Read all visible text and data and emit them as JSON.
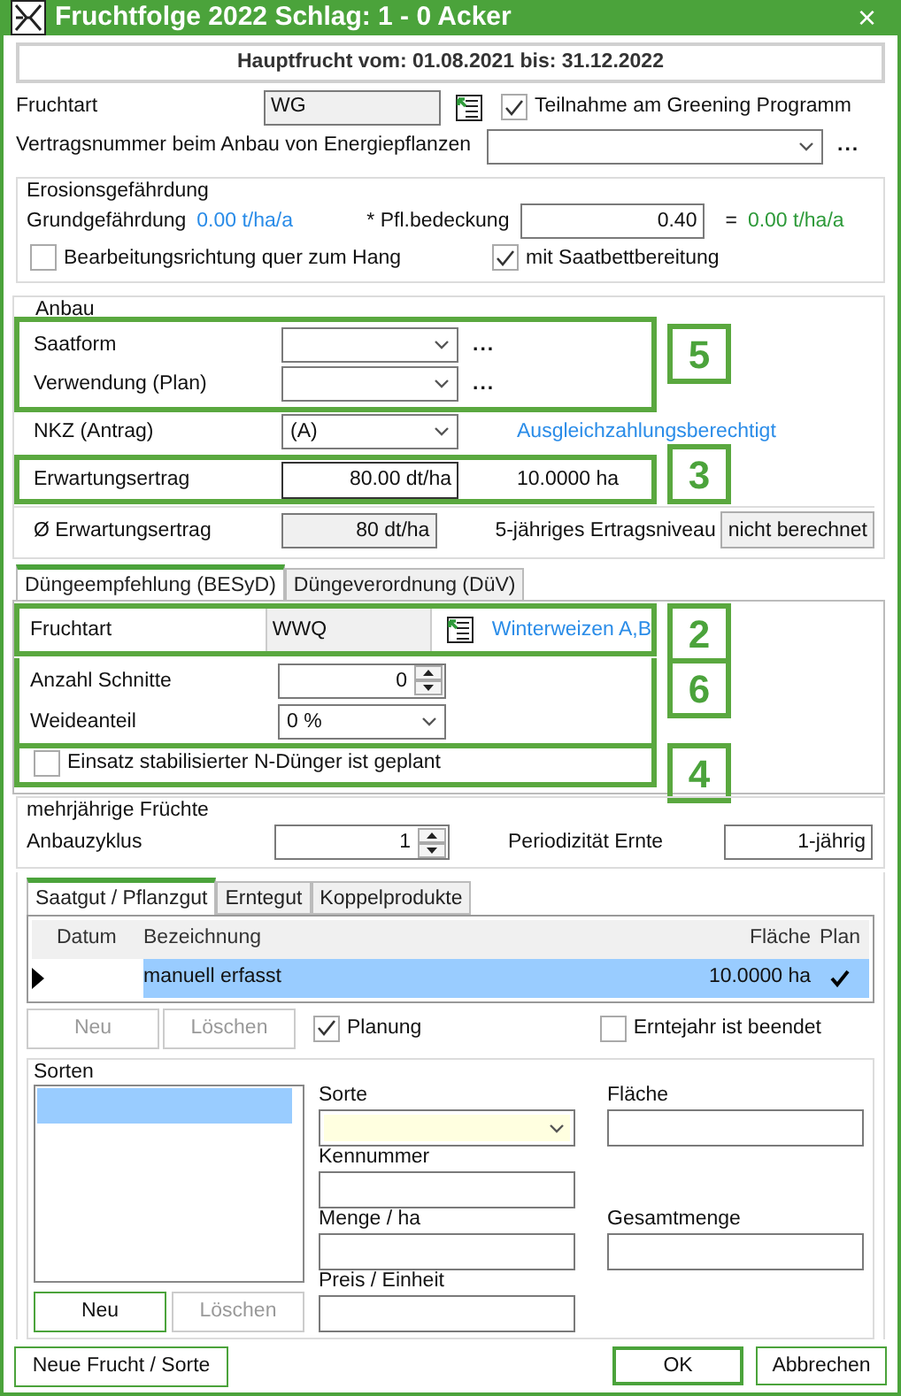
{
  "window": {
    "title": "Fruchtfolge 2022 Schlag: 1 - 0 Acker",
    "close": "×"
  },
  "header": "Hauptfrucht vom: 01.08.2021 bis: 31.12.2022",
  "fruchtart": {
    "label": "Fruchtart",
    "value": "WG",
    "greening": {
      "label": "Teilnahme am Greening Programm",
      "checked": true
    }
  },
  "vertrag": {
    "label": "Vertragsnummer beim Anbau von Energiepflanzen",
    "more": "..."
  },
  "erosion": {
    "title": "Erosionsgefährdung",
    "grund_label": "Grundgefährdung",
    "grund_value": "0.00 t/ha/a",
    "factor_label": "* Pfl.bedeckung",
    "factor_value": "0.40",
    "equals": "=",
    "result": "0.00 t/ha/a",
    "checks": [
      {
        "label": "Bearbeitungsrichtung quer zum Hang",
        "checked": false
      },
      {
        "label": "mit Saatbettbereitung",
        "checked": true
      }
    ]
  },
  "anbau": {
    "title": "Anbau",
    "callout": "5",
    "rows": [
      {
        "label": "Saatform",
        "more": "..."
      },
      {
        "label": "Verwendung (Plan)",
        "more": "..."
      }
    ]
  },
  "nkz": {
    "label": "NKZ  (Antrag)",
    "value": "(A)",
    "link": "Ausgleichzahlungsberechtigt"
  },
  "ertrag": {
    "callout": "3",
    "label": "Erwartungsertrag",
    "value": "80.00 dt/ha",
    "area": "10.0000 ha"
  },
  "durchschnitt": {
    "label": "Ø Erwartungsertrag",
    "value": "80 dt/ha",
    "niveau_label": "5-jähriges Ertragsniveau",
    "niveau_button": "nicht berechnet"
  },
  "duenge_tabs": [
    {
      "label": "Düngeempfehlung (BESyD)",
      "selected": true
    },
    {
      "label": "Düngeverordnung (DüV)",
      "selected": false
    }
  ],
  "duenge": {
    "fruchtart": {
      "callout": "2",
      "label": "Fruchtart",
      "value": "WWQ",
      "name": "Winterweizen A,B"
    },
    "schnitte": {
      "callout": "6",
      "label": "Anzahl Schnitte",
      "value": "0",
      "weide_label": "Weideanteil",
      "weide_value": "0 %"
    },
    "stabil": {
      "callout": "4",
      "label": "Einsatz stabilisierter N-Dünger ist geplant",
      "checked": false
    }
  },
  "mehrjaehrig": {
    "title": "mehrjährige Früchte",
    "zyklus_label": "Anbauzyklus",
    "zyklus_value": "1",
    "period_label": "Periodizität Ernte",
    "period_value": "1-jährig"
  },
  "gut_tabs": [
    {
      "label": "Saatgut / Pflanzgut",
      "selected": true
    },
    {
      "label": "Erntegut",
      "selected": false
    },
    {
      "label": "Koppelprodukte",
      "selected": false
    }
  ],
  "table": {
    "columns": [
      "Datum",
      "Bezeichnung",
      "Fläche",
      "Plan"
    ],
    "rows": [
      {
        "bezeichnung": "manuell erfasst",
        "flaeche": "10.0000 ha",
        "plan": true,
        "selected": true
      }
    ]
  },
  "table_buttons": [
    {
      "label": "Neu",
      "disabled": true
    },
    {
      "label": "Löschen",
      "disabled": true
    }
  ],
  "planung": {
    "label": "Planung",
    "checked": true
  },
  "erntejahr": {
    "label": "Erntejahr ist beendet",
    "checked": false
  },
  "sorten": {
    "title": "Sorten",
    "items": [
      {
        "selected": true
      }
    ],
    "buttons": [
      {
        "label": "Neu",
        "disabled": false
      },
      {
        "label": "Löschen",
        "disabled": true
      }
    ],
    "fields": [
      [
        {
          "label": "Sorte",
          "kind": "select"
        },
        {
          "label": "Fläche",
          "kind": "text"
        }
      ],
      [
        {
          "label": "Kennummer",
          "kind": "text"
        }
      ],
      [
        {
          "label": "Menge / ha",
          "kind": "text"
        },
        {
          "label": "Gesamtmenge",
          "kind": "text"
        }
      ],
      [
        {
          "label": "Preis / Einheit",
          "kind": "text"
        }
      ]
    ]
  },
  "footer": {
    "left": "Neue Frucht / Sorte",
    "buttons": [
      {
        "label": "OK",
        "default": true
      },
      {
        "label": "Abbrechen",
        "default": false
      }
    ]
  }
}
